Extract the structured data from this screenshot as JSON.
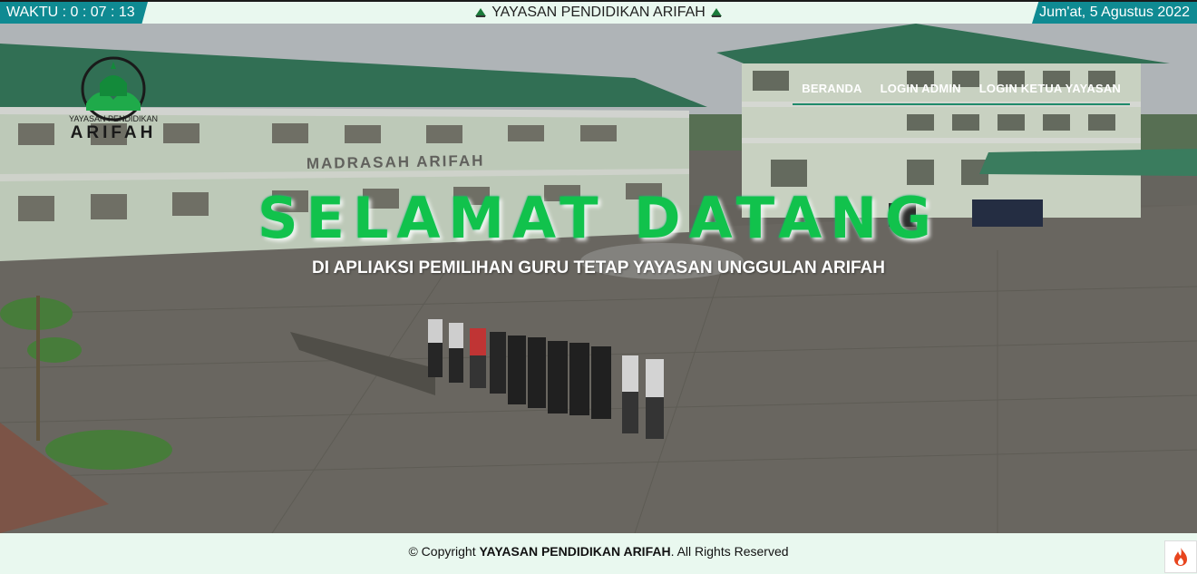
{
  "topbar": {
    "clock": "WAKTU : 0 : 07 : 13",
    "title": "YAYASAN PENDIDIKAN ARIFAH",
    "date": "Jum'at, 5 Agustus 2022"
  },
  "logo": {
    "line1": "YAYASAN PENDIDIKAN",
    "line2": "ARIFAH"
  },
  "nav": [
    "BERANDA",
    "LOGIN ADMIN",
    "LOGIN KETUA YAYASAN"
  ],
  "building_sign": "MADRASAH ARIFAH",
  "hero": {
    "heading": "SELAMAT DATANG",
    "subheading": "DI APLIAKSI PEMILIHAN GURU TETAP YAYASAN UNGGULAN ARIFAH"
  },
  "footer": {
    "prefix": "© Copyright",
    "brand": "YAYASAN PENDIDIKAN ARIFAH",
    "suffix": ". All Rights Reserved"
  },
  "colors": {
    "accent": "#0f8a92",
    "heading": "#11c24c",
    "roof": "#2f7a5a",
    "bar_bg": "#e9f8ef"
  },
  "icons": [
    "school-logo-icon",
    "fire-icon"
  ]
}
